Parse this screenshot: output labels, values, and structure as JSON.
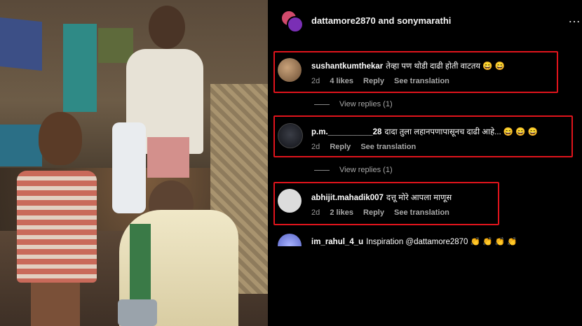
{
  "header": {
    "title": "dattamore2870 and sonymarathi",
    "more_icon": "…"
  },
  "comments": [
    {
      "username": "sushantkumthekar",
      "text": "तेव्हा पण थोडी दाढी होती वाटतय 😄 😄",
      "time": "2d",
      "likes": "4 likes",
      "reply": "Reply",
      "translate": "See translation"
    },
    {
      "username": "p.m.__________28",
      "text": "दादा तुला लहानपणापासूनच दाढी आहे... 😄 😄 😄",
      "time": "2d",
      "reply": "Reply",
      "translate": "See translation"
    },
    {
      "username": "abhijit.mahadik007",
      "text": "दत्तू मोरे आपला माणूस",
      "time": "2d",
      "likes": "2 likes",
      "reply": "Reply",
      "translate": "See translation"
    },
    {
      "username": "im_rahul_4_u",
      "text": "Inspiration @dattamore2870 👏 👏 👏 👏"
    }
  ],
  "view_replies": [
    "View replies (1)",
    "View replies (1)"
  ],
  "colors": {
    "highlight": "#e0141c",
    "background": "#000000",
    "meta": "#9a9a9a"
  }
}
